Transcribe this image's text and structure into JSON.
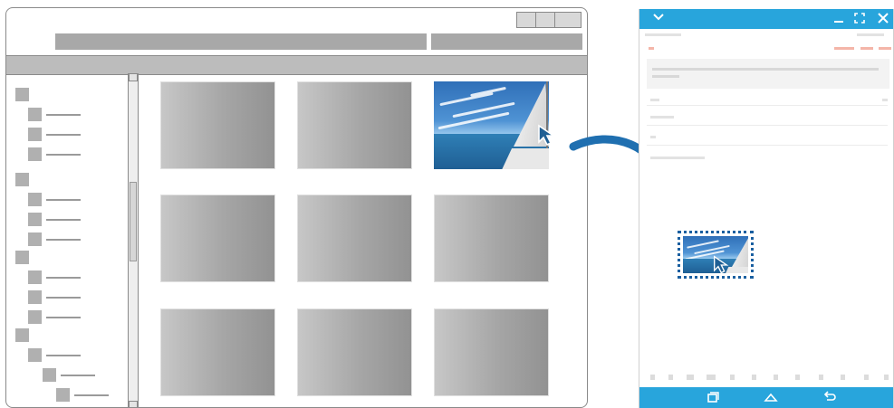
{
  "left_window": {
    "icons": {
      "minimize": "window-minimize-icon",
      "maximize": "window-maximize-icon",
      "close": "window-close-icon"
    }
  },
  "email_app": {
    "colors": {
      "bar": "#28a5dc"
    },
    "icons": {
      "collapse": "chevron-down-icon",
      "minimize": "minimize-icon",
      "expand": "expand-icon",
      "close": "close-icon",
      "recents": "recent-apps-icon",
      "home": "home-icon",
      "back": "back-icon"
    }
  },
  "colors": {
    "arrow": "#1f6fb0",
    "dropzone": "#1a5fa0"
  }
}
